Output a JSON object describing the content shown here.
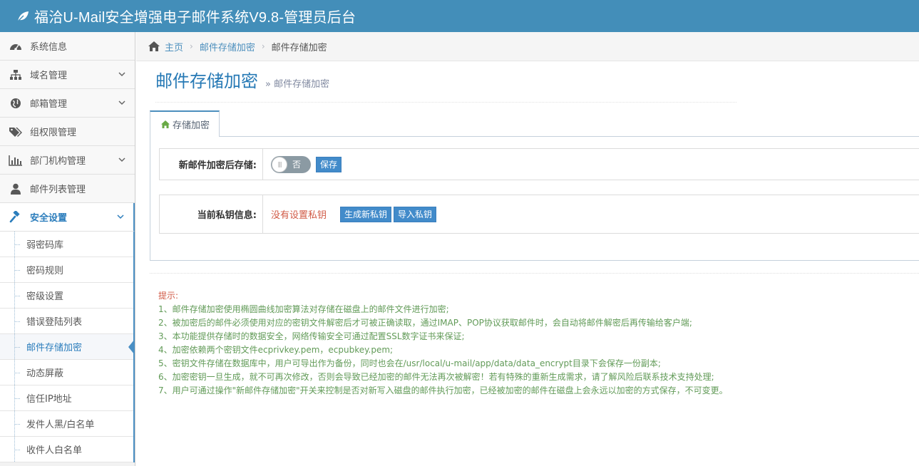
{
  "app": {
    "title": "福洽U-Mail安全增强电子邮件系统V9.8-管理员后台",
    "brand_color": "#438eb9"
  },
  "sidebar": {
    "items": [
      {
        "label": "系统信息",
        "icon": "dashboard-icon",
        "expandable": false
      },
      {
        "label": "域名管理",
        "icon": "sitemap-icon",
        "expandable": true
      },
      {
        "label": "邮箱管理",
        "icon": "globe-icon",
        "expandable": true
      },
      {
        "label": "组权限管理",
        "icon": "tags-icon",
        "expandable": false
      },
      {
        "label": "部门机构管理",
        "icon": "bar-chart-icon",
        "expandable": true
      },
      {
        "label": "邮件列表管理",
        "icon": "user-icon",
        "expandable": false
      },
      {
        "label": "安全设置",
        "icon": "gavel-icon",
        "expandable": true,
        "active": true
      }
    ],
    "sub_items": [
      {
        "label": "弱密码库"
      },
      {
        "label": "密码规则"
      },
      {
        "label": "密级设置"
      },
      {
        "label": "错误登陆列表"
      },
      {
        "label": "邮件存储加密",
        "active": true
      },
      {
        "label": "动态屏蔽"
      },
      {
        "label": "信任IP地址"
      },
      {
        "label": "发件人黑/白名单"
      },
      {
        "label": "收件人白名单"
      }
    ]
  },
  "breadcrumb": {
    "home": "主页",
    "parent": "邮件存储加密",
    "current": "邮件存储加密"
  },
  "page": {
    "title": "邮件存储加密",
    "subtitle": "邮件存储加密"
  },
  "tab": {
    "label": "存储加密"
  },
  "form": {
    "encrypt_label": "新邮件加密后存储:",
    "toggle_text": "否",
    "save_button": "保存",
    "key_label": "当前私钥信息:",
    "key_status": "没有设置私钥",
    "generate_button": "生成新私钥",
    "import_button": "导入私钥"
  },
  "tips": {
    "title": "提示:",
    "lines": [
      "1、邮件存储加密使用椭圆曲线加密算法对存储在磁盘上的邮件文件进行加密;",
      "2、被加密后的邮件必须使用对应的密钥文件解密后才可被正确读取，通过IMAP、POP协议获取邮件时，会自动将邮件解密后再传输给客户端;",
      "3、本功能提供存储时的数据安全，网络传输安全可通过配置SSL数字证书来保证;",
      "4、加密依赖两个密钥文件ecprivkey.pem，ecpubkey.pem;",
      "5、密钥文件存储在数据库中，用户可导出作为备份，同时也会在/usr/local/u-mail/app/data/data_encrypt目录下会保存一份副本;",
      "6、加密密钥一旦生成，就不可再次修改，否则会导致已经加密的邮件无法再次被解密！若有特殊的重新生成需求，请了解风险后联系技术支持处理;",
      "7、用户可通过操作\"新邮件存储加密\"开关来控制是否对新写入磁盘的邮件执行加密，已经被加密的邮件在磁盘上会永远以加密的方式保存，不可变更。"
    ]
  }
}
